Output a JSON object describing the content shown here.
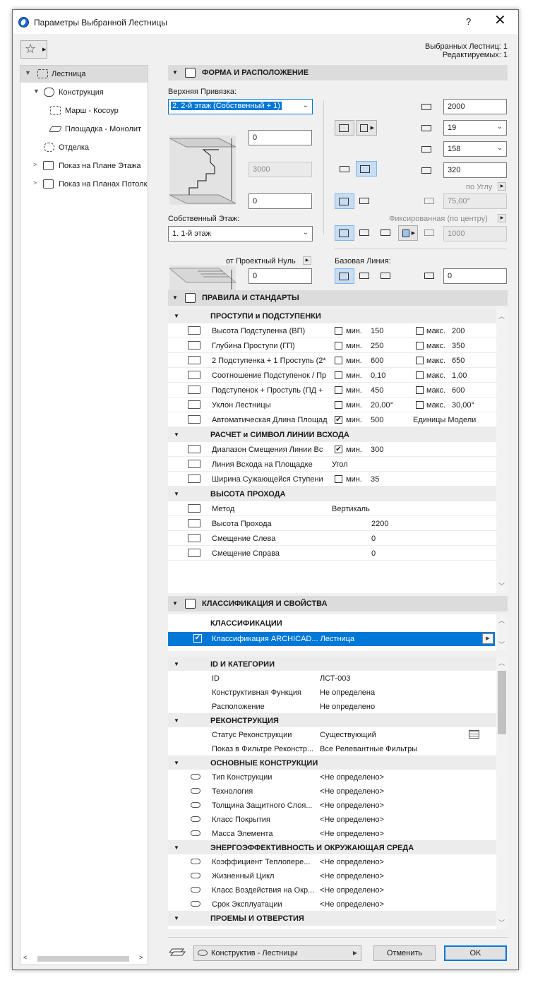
{
  "window": {
    "title": "Параметры Выбранной Лестницы",
    "help": "?",
    "close": "✕"
  },
  "selection": {
    "selected": "Выбранных Лестниц: 1",
    "editable": "Редактируемых: 1"
  },
  "tree": [
    {
      "label": "Лестница",
      "arrow": "▼",
      "icon": "stair-icon"
    },
    {
      "label": "Конструкция",
      "arrow": "▼",
      "icon": "structure-icon"
    },
    {
      "label": "Марш - Косоур",
      "arrow": "",
      "icon": "flight-icon"
    },
    {
      "label": "Площадка - Монолит",
      "arrow": "",
      "icon": "landing-icon"
    },
    {
      "label": "Отделка",
      "arrow": "",
      "icon": "finish-icon"
    },
    {
      "label": "Показ на Плане Этажа",
      "arrow": ">",
      "icon": "floor-plan-icon"
    },
    {
      "label": "Показ на Планах Потолка",
      "arrow": ">",
      "icon": "ceiling-plan-icon"
    }
  ],
  "shape": {
    "title": "ФОРМА И РАСПОЛОЖЕНИЕ",
    "top_link_label": "Верхняя Привязка:",
    "top_link_value": "2. 2-й этаж (Собственный + 1)",
    "top_offset": "0",
    "height": "3000",
    "bottom_offset": "0",
    "home_story_label": "Собственный Этаж:",
    "home_story_value": "1. 1-й этаж",
    "from_zero_label": "от Проектный Нуль",
    "from_zero_value": "0",
    "width": "2000",
    "risers": "19",
    "riser_height": "158",
    "tread_depth": "320",
    "by_angle_label": "по Углу",
    "angle": "75,00°",
    "fixed_label": "Фиксированная (по центру)",
    "fixed_value": "1000",
    "baseline_label": "Базовая Линия:",
    "baseline_offset": "0"
  },
  "rules": {
    "title": "ПРАВИЛА И СТАНДАРТЫ",
    "group1": "ПРОСТУПИ и ПОДСТУПЕНКИ",
    "rows1": [
      {
        "name": "Высота Подступенка (ВП)",
        "min_chk": "",
        "min_lbl": "мин.",
        "min": "150",
        "max_chk": "",
        "max_lbl": "макс.",
        "max": "200"
      },
      {
        "name": "Глубина Проступи (ГП)",
        "min_chk": "",
        "min_lbl": "мин.",
        "min": "250",
        "max_chk": "",
        "max_lbl": "макс.",
        "max": "350"
      },
      {
        "name": "2 Подступенка + 1 Проступь (2*",
        "min_chk": "",
        "min_lbl": "мин.",
        "min": "600",
        "max_chk": "",
        "max_lbl": "макс.",
        "max": "650"
      },
      {
        "name": "Соотношение Подступенок / Пр",
        "min_chk": "",
        "min_lbl": "мин.",
        "min": "0,10",
        "max_chk": "",
        "max_lbl": "макс.",
        "max": "1,00"
      },
      {
        "name": "Подступенок + Проступь (ПД +",
        "min_chk": "",
        "min_lbl": "мин.",
        "min": "450",
        "max_chk": "",
        "max_lbl": "макс.",
        "max": "600"
      },
      {
        "name": "Уклон Лестницы",
        "min_chk": "",
        "min_lbl": "мин.",
        "min": "20,00°",
        "max_chk": "",
        "max_lbl": "макс.",
        "max": "30,00°"
      },
      {
        "name": "Автоматическая Длина Площад",
        "min_chk": "✔",
        "min_lbl": "мин.",
        "min": "500",
        "units": "Единицы Модели"
      }
    ],
    "group2": "РАСЧЕТ и СИМВОЛ ЛИНИИ ВСХОДА",
    "rows2": [
      {
        "name": "Диапазон Смещения Линии Вс",
        "chk": "✔",
        "lbl": "мин.",
        "val": "300"
      },
      {
        "name": "Линия Всхода на Площадке",
        "text": "Угол"
      },
      {
        "name": "Ширина Сужающейся Ступени",
        "chk": "",
        "lbl": "мин.",
        "val": "35"
      }
    ],
    "group3": "ВЫСОТА ПРОХОДА",
    "rows3": [
      {
        "name": "Метод",
        "val": "Вертикаль"
      },
      {
        "name": "Высота Прохода",
        "val": "2200"
      },
      {
        "name": "Смещение Слева",
        "val": "0"
      },
      {
        "name": "Смещение Справа",
        "val": "0"
      }
    ]
  },
  "classification": {
    "title": "КЛАССИФИКАЦИЯ И СВОЙСТВА",
    "group": "КЛАССИФИКАЦИИ",
    "row": "Классификация ARCHICAD... Лестница",
    "row_check": "✔"
  },
  "props": {
    "groups": [
      {
        "name": "ID И КАТЕГОРИИ",
        "rows": [
          {
            "k": "ID",
            "v": "ЛСТ-003",
            "link": false
          },
          {
            "k": "Конструктивная Функция",
            "v": "Не определена",
            "link": false
          },
          {
            "k": "Расположение",
            "v": "Не определено",
            "link": false
          }
        ]
      },
      {
        "name": "РЕКОНСТРУКЦИЯ",
        "rows": [
          {
            "k": "Статус Реконструкции",
            "v": "Существующий",
            "link": false
          },
          {
            "k": "Показ в Фильтре Реконстр...",
            "v": "Все Релевантные Фильтры",
            "link": false
          }
        ]
      },
      {
        "name": "ОСНОВНЫЕ КОНСТРУКЦИИ",
        "rows": [
          {
            "k": "Тип Конструкции",
            "v": "<Не определено>",
            "link": true
          },
          {
            "k": "Технология",
            "v": "<Не определено>",
            "link": true
          },
          {
            "k": "Толщина Защитного Слоя...",
            "v": "<Не определено>",
            "link": true
          },
          {
            "k": "Класс Покрытия",
            "v": "<Не определено>",
            "link": true
          },
          {
            "k": "Масса Элемента",
            "v": "<Не определено>",
            "link": true
          }
        ]
      },
      {
        "name": "ЭНЕРГОЭФФЕКТИВНОСТЬ И ОКРУЖАЮЩАЯ СРЕДА",
        "rows": [
          {
            "k": "Коэффициент Теплопере...",
            "v": "<Не определено>",
            "link": true
          },
          {
            "k": "Жизненный Цикл",
            "v": "<Не определено>",
            "link": true
          },
          {
            "k": "Класс Воздействия на Окр...",
            "v": "<Не определено>",
            "link": true
          },
          {
            "k": "Срок Эксплуатации",
            "v": "<Не определено>",
            "link": true
          }
        ]
      },
      {
        "name": "ПРОЕМЫ И ОТВЕРСТИЯ",
        "rows": []
      }
    ]
  },
  "footer": {
    "layer": "Конструктив - Лестницы",
    "cancel": "Отменить",
    "ok": "OK"
  }
}
